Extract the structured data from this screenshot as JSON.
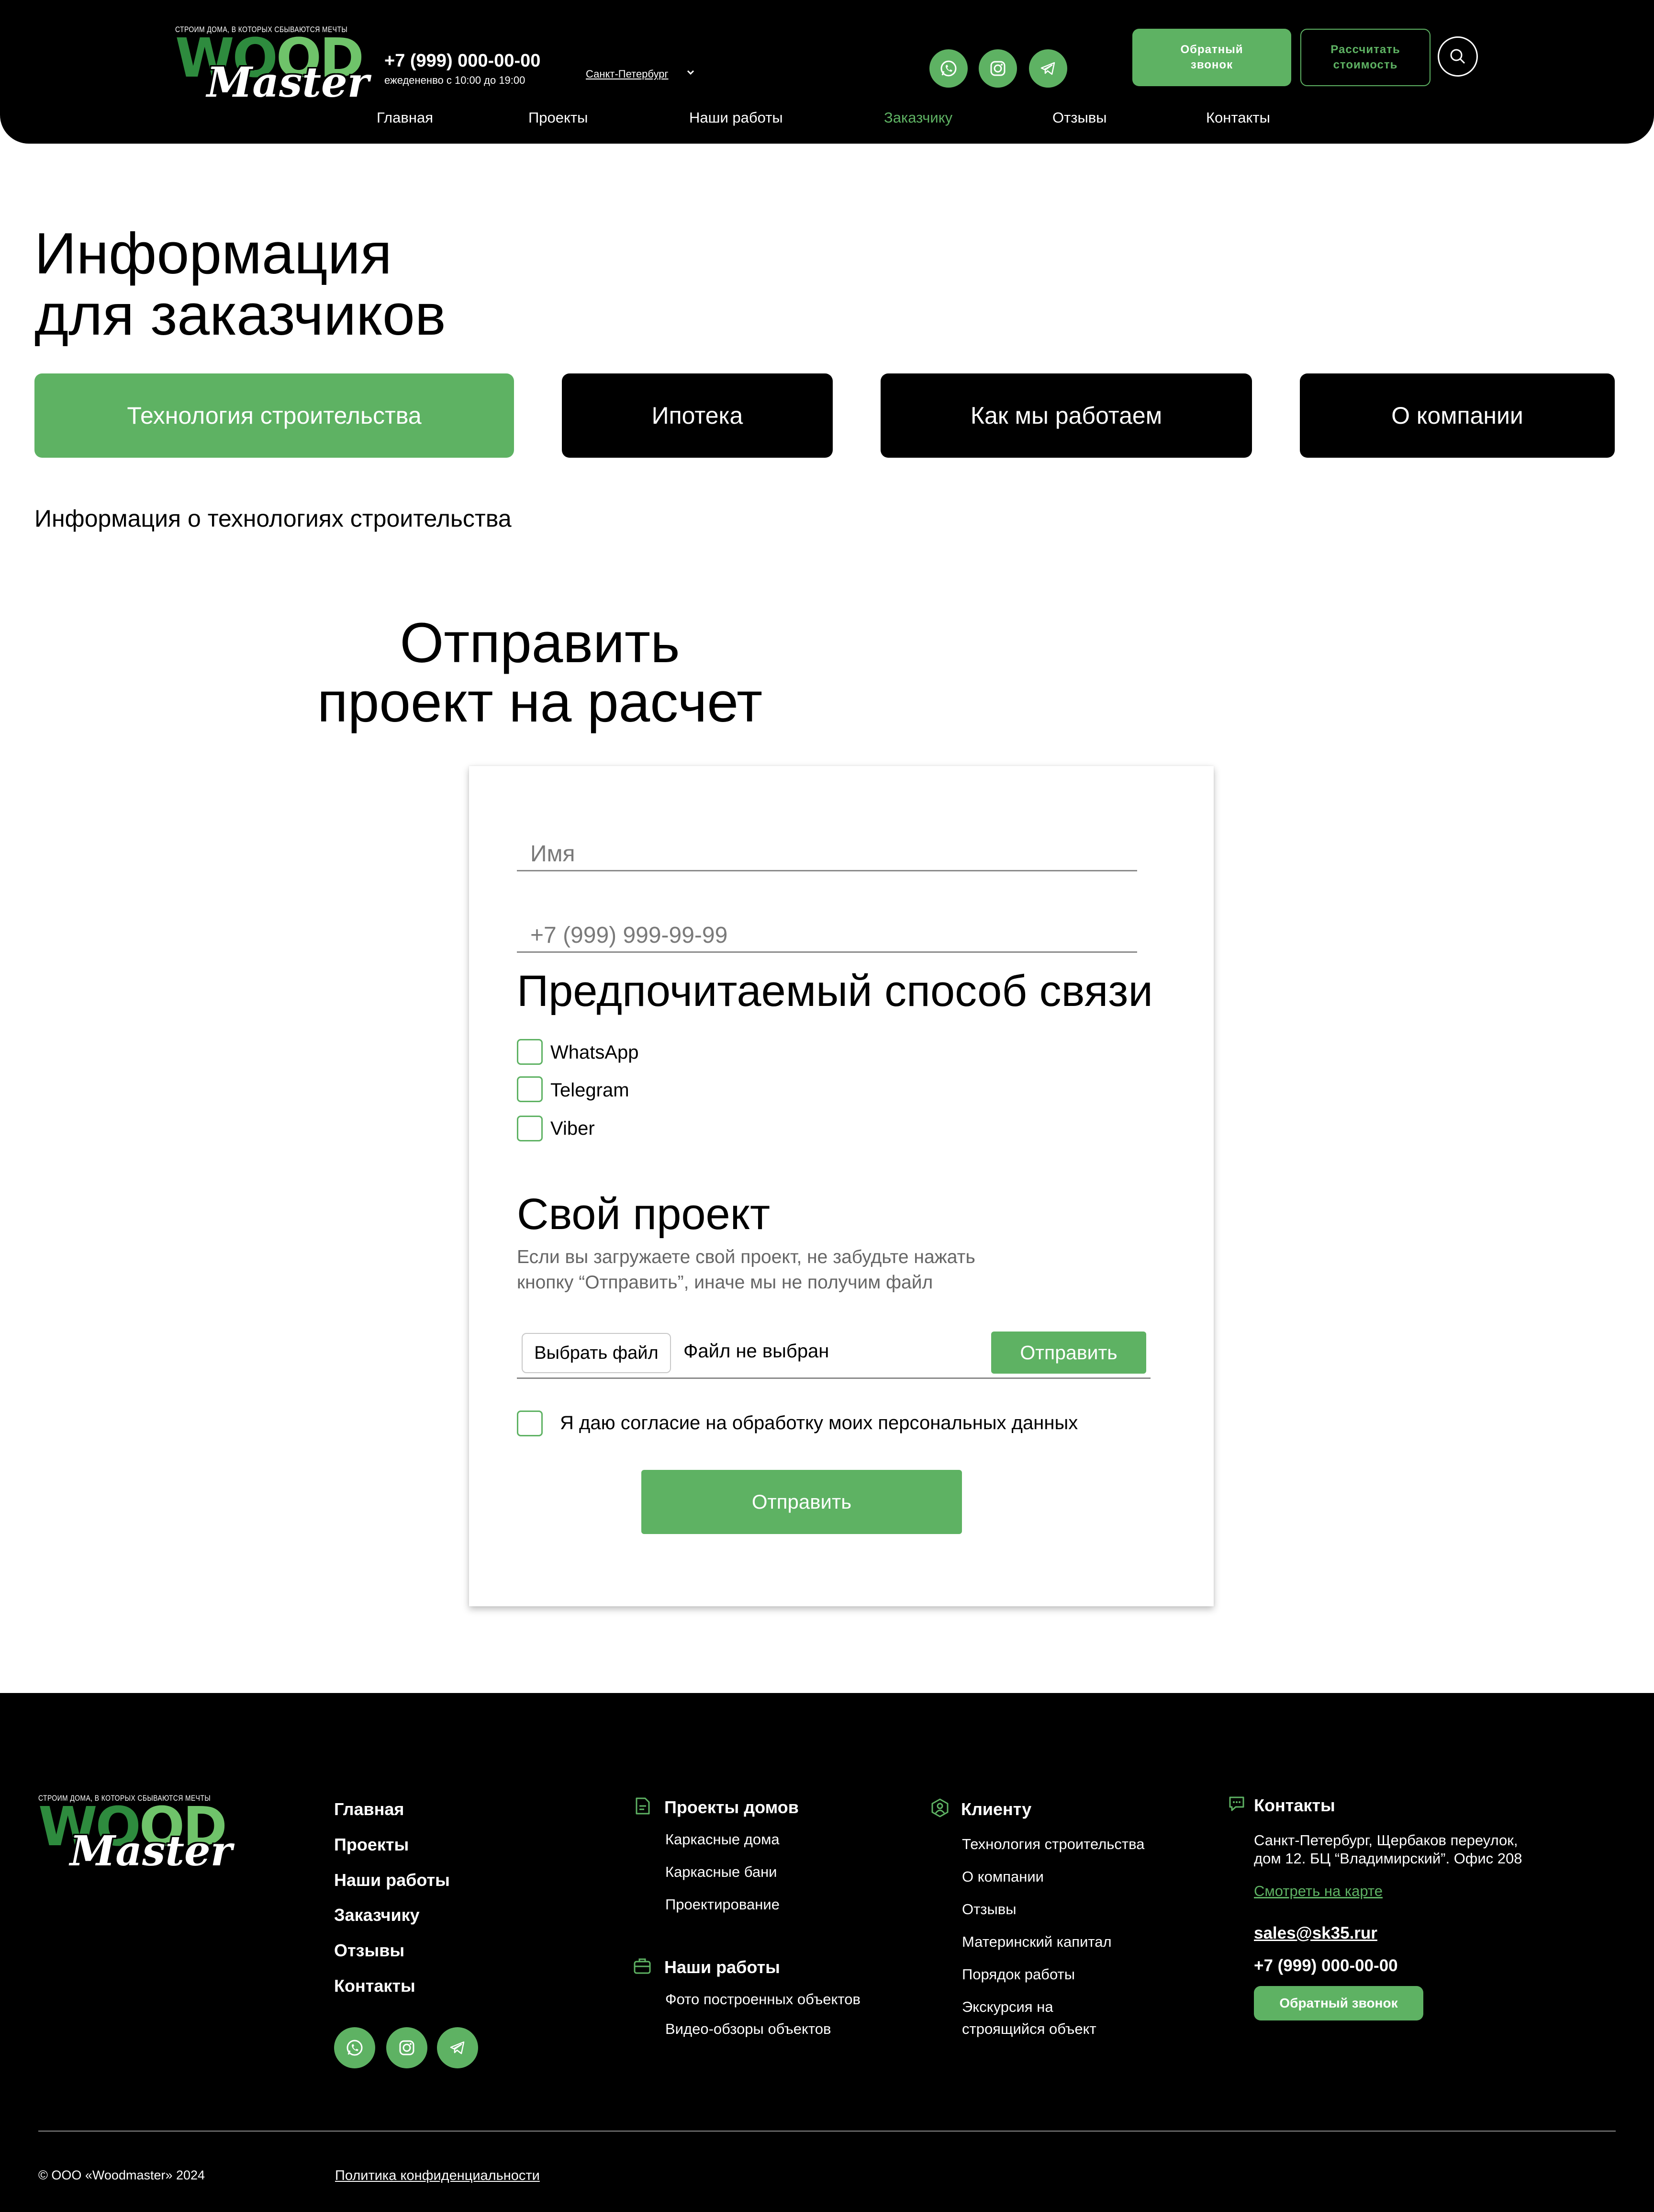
{
  "brand": {
    "tagline": "СТРОИМ ДОМА, В КОТОРЫХ СБЫВАЮТСЯ МЕЧТЫ",
    "logo_word_1": "WOOD",
    "logo_word_2": "Master"
  },
  "header": {
    "phone": "+7 (999) 000-00-00",
    "hours": "ежедененво с 10:00 до 19:00",
    "city": "Санкт-Петербург",
    "callback_button": "Обратный звонок",
    "calc_button": "Рассчитать стоимость",
    "socials": [
      "whatsapp-icon",
      "instagram-icon",
      "telegram-icon"
    ],
    "nav": [
      {
        "label": "Главная",
        "active": false
      },
      {
        "label": "Проекты",
        "active": false
      },
      {
        "label": "Наши работы",
        "active": false
      },
      {
        "label": "Заказчику",
        "active": true
      },
      {
        "label": "Отзывы",
        "active": false
      },
      {
        "label": "Контакты",
        "active": false
      }
    ]
  },
  "main": {
    "title_line1": "Информация",
    "title_line2": "для заказчиков",
    "tabs": [
      {
        "label": "Технология строительства",
        "active": true
      },
      {
        "label": "Ипотека",
        "active": false
      },
      {
        "label": "Как мы работаем",
        "active": false
      },
      {
        "label": "О компании",
        "active": false
      }
    ],
    "tab_content": "Информация о технологиях строительства"
  },
  "form": {
    "title_line1": "Отправить",
    "title_line2": "проект на расчет",
    "name_placeholder": "Имя",
    "phone_placeholder": "+7 (999) 999-99-99",
    "contact_method_title": "Предпочитаемый способ связи",
    "contact_methods": [
      "WhatsApp",
      "Telegram",
      "Viber"
    ],
    "own_project_title": "Свой проект",
    "own_project_note_line1": "Если вы загружаете свой проект, не забудьте нажать",
    "own_project_note_line2": "кнопку “Отправить”, иначе мы не получим файл",
    "choose_file_button": "Выбрать файл",
    "no_file_text": "Файл не выбран",
    "upload_button": "Отправить",
    "consent_label": "Я даю согласие на обработку моих персональных данных",
    "submit_button": "Отправить"
  },
  "footer": {
    "main_links": [
      "Главная",
      "Проекты",
      "Наши работы",
      "Заказчику",
      "Отзывы",
      "Контакты"
    ],
    "projects_title": "Проекты домов",
    "projects_links": [
      "Каркасные дома",
      "Каркасные бани",
      "Проектирование"
    ],
    "works_title": "Наши работы",
    "works_links": [
      "Фото построенных объектов",
      "Видео-обзоры объектов"
    ],
    "client_title": "Клиенту",
    "client_links": [
      "Технология строительства",
      "О компании",
      "Отзывы",
      "Материнский капитал",
      "Порядок работы",
      "Экскурсия на",
      "строящийся объект"
    ],
    "contacts_title": "Контакты",
    "address_line1": "Санкт-Петербург, Щербаков переулок,",
    "address_line2": "дом 12. БЦ “Владимирский”. Офис 208",
    "map_link": "Смотреть на карте",
    "email": "sales@sk35.rur",
    "phone": "+7 (999) 000-00-00",
    "callback_button": "Обратный звонок",
    "copyright": "© ООО «Woodmaster» 2024",
    "policy": "Политика конфиденциальности"
  },
  "colors": {
    "accent": "#5eb263",
    "dark": "#000000",
    "logo_green": "#2e8b3e"
  }
}
